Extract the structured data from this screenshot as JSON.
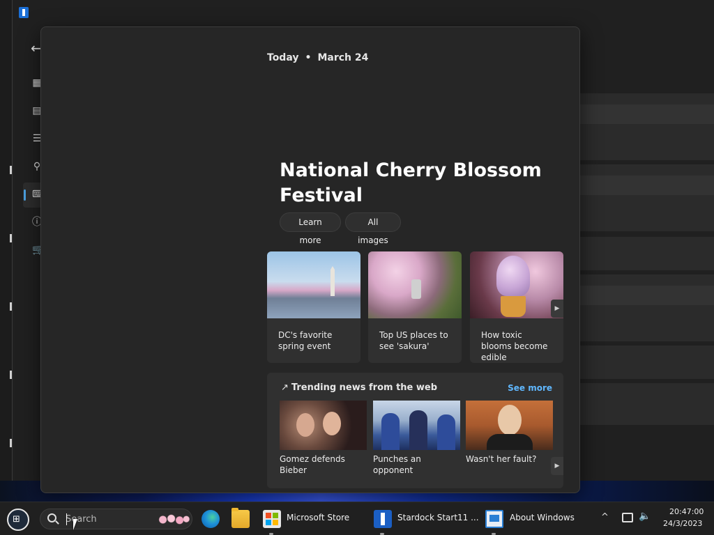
{
  "widget": {
    "date_prefix": "Today",
    "date_sep": "•",
    "date": "March 24",
    "hero_title": "National Cherry Blossom Festival",
    "buttons": {
      "learn_more": "Learn more",
      "all_images": "All images"
    },
    "cards": [
      {
        "caption": "DC's favorite spring event"
      },
      {
        "caption": "Top US places to see 'sakura'"
      },
      {
        "caption": "How toxic blooms become edible"
      }
    ],
    "trending": {
      "heading": "Trending news from the web",
      "see_more": "See more",
      "items": [
        {
          "caption": "Gomez defends Bieber"
        },
        {
          "caption": "Punches an opponent"
        },
        {
          "caption": "Wasn't her fault?"
        }
      ]
    }
  },
  "taskbar": {
    "search_placeholder": "Search",
    "apps": [
      {
        "label": "Microsoft Store"
      },
      {
        "label": "Stardock Start11 ..."
      },
      {
        "label": "About Windows"
      }
    ],
    "clock": {
      "time": "20:47:00",
      "date": "24/3/2023"
    }
  },
  "icons": [
    "back-arrow-icon",
    "search-icon",
    "edge-icon",
    "folder-icon",
    "store-icon",
    "stardock-icon",
    "about-icon",
    "chevron-up-icon",
    "network-icon",
    "volume-icon"
  ]
}
